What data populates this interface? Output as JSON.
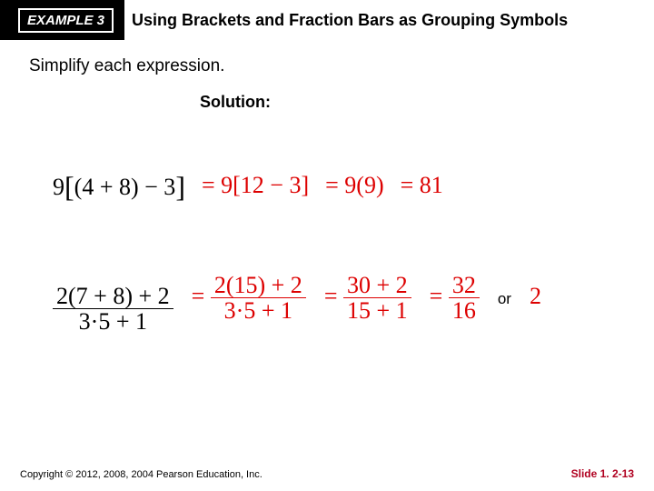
{
  "header": {
    "badge": "EXAMPLE 3",
    "title": "Using Brackets and Fraction Bars as Grouping Symbols"
  },
  "instruction": "Simplify each expression.",
  "solution_label": "Solution:",
  "row1": {
    "expr": "9[(4 + 8) − 3]",
    "step1": "= 9[12 − 3]",
    "step2": "= 9(9)",
    "result": "= 81"
  },
  "row2": {
    "expr_num": "2(7 + 8) + 2",
    "expr_den": "3·5 + 1",
    "step1_num": "2(15) + 2",
    "step1_den": "3·5 + 1",
    "step2_num": "30 + 2",
    "step2_den": "15 + 1",
    "step3_num": "32",
    "step3_den": "16",
    "or": "or",
    "result": "2"
  },
  "footer": {
    "copyright": "Copyright © 2012, 2008, 2004 Pearson Education, Inc.",
    "slide": "Slide 1. 2-13"
  }
}
